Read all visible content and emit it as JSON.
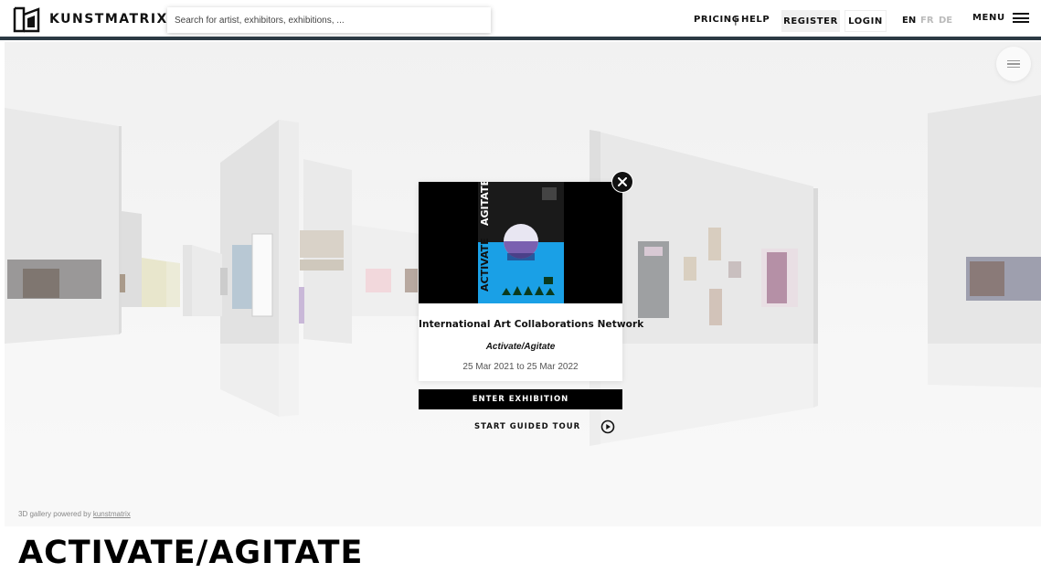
{
  "header": {
    "brand": "KUNSTMATRIX",
    "search_placeholder": "Search for artist, exhibitors, exhibitions, ...",
    "pricing": "PRICING",
    "separator": "|",
    "help": "HELP",
    "register": "REGISTER",
    "login": "LOGIN",
    "languages": [
      "EN",
      "FR",
      "DE"
    ],
    "active_language": "EN",
    "menu": "MENU"
  },
  "card": {
    "organization": "International Art Collaborations Network",
    "title": "Activate/Agitate",
    "dates": "25 Mar 2021 to 25 Mar 2022",
    "enter": "ENTER EXHIBITION",
    "tour": "START GUIDED TOUR"
  },
  "viewport": {
    "powered_prefix": "3D gallery powered by",
    "powered_link": "kunstmatrix"
  },
  "page": {
    "title": "ACTIVATE/AGITATE"
  },
  "colors": {
    "header_rule": "#2c3a44",
    "poster_blue": "#1aa0e6",
    "poster_dark": "#111111"
  }
}
